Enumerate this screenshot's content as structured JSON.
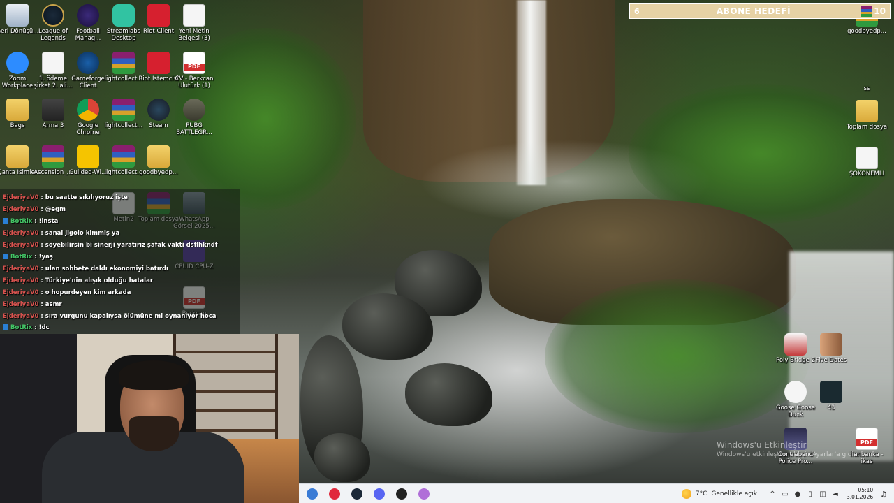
{
  "desktop_icons_left": [
    {
      "name": "recycle-bin",
      "label": "Geri Dönüşü...",
      "kind": "recycle"
    },
    {
      "name": "league-of-legends",
      "label": "League of Legends",
      "kind": "lol"
    },
    {
      "name": "football-manager",
      "label": "Football Manag...",
      "kind": "fm"
    },
    {
      "name": "streamlabs",
      "label": "Streamlabs Desktop",
      "kind": "streamlabs"
    },
    {
      "name": "riot-client",
      "label": "Riot Client",
      "kind": "riot"
    },
    {
      "name": "yeni-metin",
      "label": "Yeni Metin Belgesi (3)",
      "kind": "doc"
    },
    {
      "name": "zoom",
      "label": "Zoom Workplace",
      "kind": "zoom"
    },
    {
      "name": "odeme-sirket",
      "label": "1. ödeme şirket 2. ali...",
      "kind": "doc"
    },
    {
      "name": "gameforge",
      "label": "Gameforge Client",
      "kind": "gameforge"
    },
    {
      "name": "lightcollect-1",
      "label": "lightcollect...",
      "kind": "rar"
    },
    {
      "name": "riot-istemcisi",
      "label": "Riot İstemcisi",
      "kind": "riot"
    },
    {
      "name": "cv-berkcan",
      "label": "CV - Berkcan Ulutürk (1)",
      "kind": "pdf"
    },
    {
      "name": "bags",
      "label": "Bags",
      "kind": "folder"
    },
    {
      "name": "arma-3",
      "label": "Arma 3",
      "kind": "arma"
    },
    {
      "name": "google-chrome",
      "label": "Google Chrome",
      "kind": "chrome"
    },
    {
      "name": "lightcollect-2",
      "label": "lightcollect...",
      "kind": "rar"
    },
    {
      "name": "steam",
      "label": "Steam",
      "kind": "steam"
    },
    {
      "name": "pubg",
      "label": "PUBG BATTLEGR...",
      "kind": "pubg"
    },
    {
      "name": "canta-isimler",
      "label": "Çanta İsimler",
      "kind": "folder"
    },
    {
      "name": "ascension",
      "label": "Ascension_...",
      "kind": "rar"
    },
    {
      "name": "guilded",
      "label": "Guilded-Wi...",
      "kind": "guilded"
    },
    {
      "name": "lightcollect-3",
      "label": "lightcollect...",
      "kind": "rar"
    },
    {
      "name": "goodbyedp-1",
      "label": "goodbyedp...",
      "kind": "folder"
    }
  ],
  "desktop_icons_left_partial": [
    {
      "name": "metin2",
      "label": "Metin2",
      "kind": "doc"
    },
    {
      "name": "toplam-dosya-left",
      "label": "Toplam dosya",
      "kind": "rar"
    },
    {
      "name": "whatsapp-gorsel",
      "label": "WhatsApp Görsel 2025...",
      "kind": "photo"
    },
    {
      "name": "cpuid",
      "label": "CPUID CPU-Z",
      "kind": "cpuz"
    },
    {
      "name": "berkcan-pdf",
      "label": "Berkcan",
      "kind": "pdf"
    }
  ],
  "desktop_icons_right": [
    {
      "name": "goodbyedp-2",
      "label": "goodbyedp...",
      "kind": "rar"
    },
    {
      "name": "ss",
      "label": "ss",
      "kind": "ss"
    },
    {
      "name": "toplam-dosya-right",
      "label": "Toplam dosya",
      "kind": "folder"
    },
    {
      "name": "sokonemli",
      "label": "ŞOKONEMLİ",
      "kind": "doc"
    },
    {
      "name": "poly-bridge-2",
      "label": "Poly Bridge 2",
      "kind": "poly"
    },
    {
      "name": "five-dates",
      "label": "Five Dates",
      "kind": "five"
    },
    {
      "name": "goose-goose-duck",
      "label": "Goose Goose Duck",
      "kind": "goose"
    },
    {
      "name": "icon-43",
      "label": "43",
      "kind": "dark"
    },
    {
      "name": "contraband-police",
      "label": "Contraband Police Pro...",
      "kind": "contraband"
    },
    {
      "name": "ilanbanka",
      "label": "İlanbanka - ikas",
      "kind": "pdf"
    }
  ],
  "subscriber_goal": {
    "current": "6",
    "title": "ABONE HEDEFİ",
    "target": "10"
  },
  "chat": [
    {
      "user": "EjderiyaV0",
      "text": "bu saatte sıkılıyoruz işte",
      "kind": "user"
    },
    {
      "user": "EjderiyaV0",
      "text": "@egm",
      "kind": "user"
    },
    {
      "user": "BotRix",
      "text": "!insta",
      "kind": "bot"
    },
    {
      "user": "EjderiyaV0",
      "text": "sanal jigolo kimmiş ya",
      "kind": "user"
    },
    {
      "user": "EjderiyaV0",
      "text": "söyebilirsin bi sinerji yaratırız şafak vakti dsflhkndf",
      "kind": "user"
    },
    {
      "user": "BotRix",
      "text": "!yaş",
      "kind": "bot"
    },
    {
      "user": "EjderiyaV0",
      "text": "ulan sohbete daldı ekonomiyi batırdı",
      "kind": "user"
    },
    {
      "user": "EjderiyaV0",
      "text": "Türkiye'nin alışık olduğu hatalar",
      "kind": "user"
    },
    {
      "user": "EjderiyaV0",
      "text": "o hopurdeyen kim arkada",
      "kind": "user"
    },
    {
      "user": "EjderiyaV0",
      "text": "asmr",
      "kind": "user"
    },
    {
      "user": "EjderiyaV0",
      "text": "sıra vurgunu kapalıysa ölümüne mi oynanıyor hoca",
      "kind": "user"
    },
    {
      "user": "BotRix",
      "text": "!dc",
      "kind": "bot"
    }
  ],
  "watermark": {
    "line1": "Windows'u Etkinleştir",
    "line2": "Windows'u etkinleştirmek için Ayarlar'a gidin."
  },
  "taskbar": {
    "apps": [
      {
        "name": "taskbar-app-folder",
        "color": "#3a7bd5"
      },
      {
        "name": "taskbar-app-opera",
        "color": "#e0283c"
      },
      {
        "name": "taskbar-app-steam",
        "color": "#1b2838"
      },
      {
        "name": "taskbar-app-discord",
        "color": "#5865f2"
      },
      {
        "name": "taskbar-app-obs",
        "color": "#222222"
      },
      {
        "name": "taskbar-app-streamlabs",
        "color": "#b06fd8"
      }
    ],
    "weather": {
      "temp": "7°C",
      "desc": "Genellikle açık"
    },
    "time": "05:10",
    "date": "3.01.2026"
  }
}
